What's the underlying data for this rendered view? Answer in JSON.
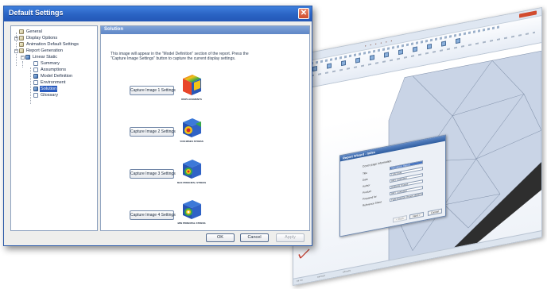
{
  "dialog": {
    "title": "Default Settings",
    "panel_title": "Solution",
    "description": "This image will appear in the \"Model Definition\" section of the report. Press the \"Capture Image Settings\" button to capture the current display settings.",
    "buttons": {
      "ok": "OK",
      "cancel": "Cancel",
      "apply": "Apply"
    }
  },
  "tree": {
    "items": [
      {
        "label": "General"
      },
      {
        "label": "Display Options"
      },
      {
        "label": "Animation Default Settings"
      },
      {
        "label": "Report Generation"
      },
      {
        "label": "Linear Static"
      },
      {
        "label": "Summary"
      },
      {
        "label": "Assumptions"
      },
      {
        "label": "Model Definition"
      },
      {
        "label": "Environment"
      },
      {
        "label": "Solution",
        "selected": true
      },
      {
        "label": "Glossary"
      }
    ]
  },
  "captures": [
    {
      "button": "Capture Image 1 Settings",
      "caption": "DISPLACEMENTS"
    },
    {
      "button": "Capture Image 2 Settings",
      "caption": "VON MISES STRESS"
    },
    {
      "button": "Capture Image 3 Settings",
      "caption": "MAX PRINCIPAL STRESS"
    },
    {
      "button": "Capture Image 4 Settings",
      "caption": "MIN PRINCIPAL STRESS"
    }
  ],
  "app_dialog": {
    "title": "Report Wizard - Index",
    "heading": "Cover page information",
    "fields": [
      {
        "label": "Title",
        "value": "Simulation Report",
        "selected": true
      },
      {
        "label": "Date",
        "value": "11/6/2008"
      },
      {
        "label": "Author",
        "value": "ANY Customer"
      },
      {
        "label": "Product",
        "value": "Analysis Project"
      },
      {
        "label": "Prepared for",
        "value": "ANY Customer"
      },
      {
        "label": "Reference Sheet",
        "value": "FEM Analysis Report 2008 D&D"
      }
    ],
    "buttons": {
      "back": "< Back",
      "next": "Next >",
      "cancel": "Cancel"
    }
  },
  "colors": {
    "title_bar": "#2a63c4",
    "selection": "#2a5cc0",
    "panel_header": "#6a8fcc",
    "mesh_plate": "#c9d4e6",
    "mesh_edge": "#2f2f2f"
  }
}
